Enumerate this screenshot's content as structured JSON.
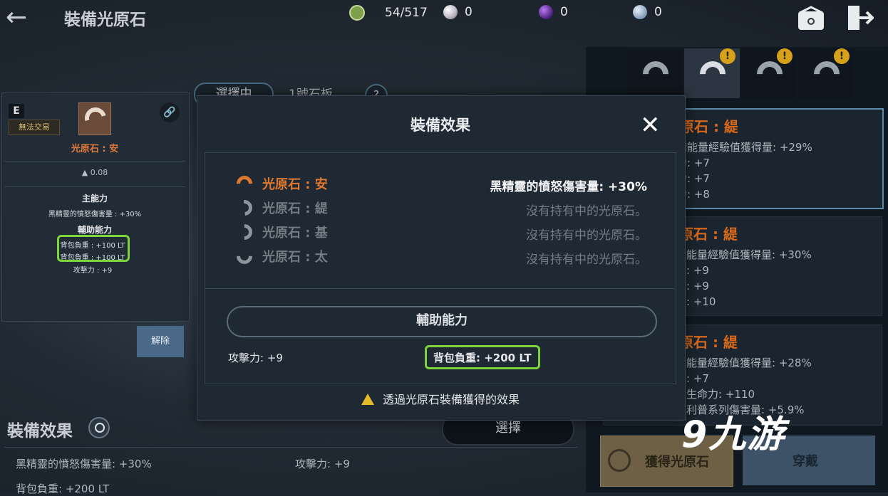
{
  "header": {
    "back_icon": "←",
    "title": "裝備光原石",
    "resources": [
      {
        "icon": "green-stone-icon",
        "value": "54/517"
      },
      {
        "icon": "pearl-icon",
        "value": "0"
      },
      {
        "icon": "purple-orb-icon",
        "value": "0"
      },
      {
        "icon": "silver-coin-icon",
        "value": "0"
      }
    ],
    "bag_icon": "bag-icon",
    "exit_icon": "exit-icon"
  },
  "left_item": {
    "grade": "E",
    "trade": "無法交易",
    "link_icon": "🔗",
    "name": "光原石 : 安",
    "weight": "▲ 0.08",
    "main_title": "主能力",
    "main_stat": "黑精靈的憤怒傷害量 : +30%",
    "sub_title": "輔助能力",
    "sub_stats": [
      "背包負重 : +100 LT",
      "背包負重 : +100 LT",
      "攻擊力 : +9"
    ],
    "unequip": "解除"
  },
  "bg_tabs": {
    "active": "選擇中",
    "second": "1號石板",
    "help": "?"
  },
  "modal": {
    "title": "裝備效果",
    "close": "✕",
    "rows": [
      {
        "name": "光原石 : 安",
        "value": "黑精靈的憤怒傷害量: +30%",
        "active": true
      },
      {
        "name": "光原石 : 緹",
        "value": "沒有持有中的光原石。",
        "active": false
      },
      {
        "name": "光原石 : 基",
        "value": "沒有持有中的光原石。",
        "active": false
      },
      {
        "name": "光原石 : 太",
        "value": "沒有持有中的光原石。",
        "active": false
      }
    ],
    "sub_title": "輔助能力",
    "stat_left": "攻擊力: +9",
    "stat_right": "背包負重: +200 LT",
    "footer": "透過光原石裝備獲得的效果"
  },
  "right_cards": [
    {
      "name": "光原石 : 緹",
      "lines": [
        "黑暗能量經驗值獲得量: +29%",
        "防力: +7",
        "防力: +7",
        "防力: +8"
      ]
    },
    {
      "name": "光原石 : 緹",
      "lines": [
        "黑暗能量經驗值獲得量: +30%",
        "防力: +9",
        "防力: +9",
        "防力: +10"
      ]
    },
    {
      "name": "光原石 : 緹",
      "lines": [
        "黑暗能量經驗值獲得量: +28%",
        "防力: +7",
        "最大生命力: +110",
        "拉夫利普系列傷害量: +5.9%"
      ]
    }
  ],
  "right_buttons": {
    "get": "獲得光原石",
    "wear": "穿戴"
  },
  "bottom": {
    "title": "裝備效果",
    "select": "選擇",
    "effects": [
      "黑精靈的憤怒傷害量: +30%",
      "攻擊力: +9",
      "背包負重: +200 LT"
    ]
  },
  "watermark": "9九游",
  "colors": {
    "accent_orange": "#e0792f",
    "highlight_green": "#7bd53b",
    "warning_yellow": "#e5b92a"
  }
}
